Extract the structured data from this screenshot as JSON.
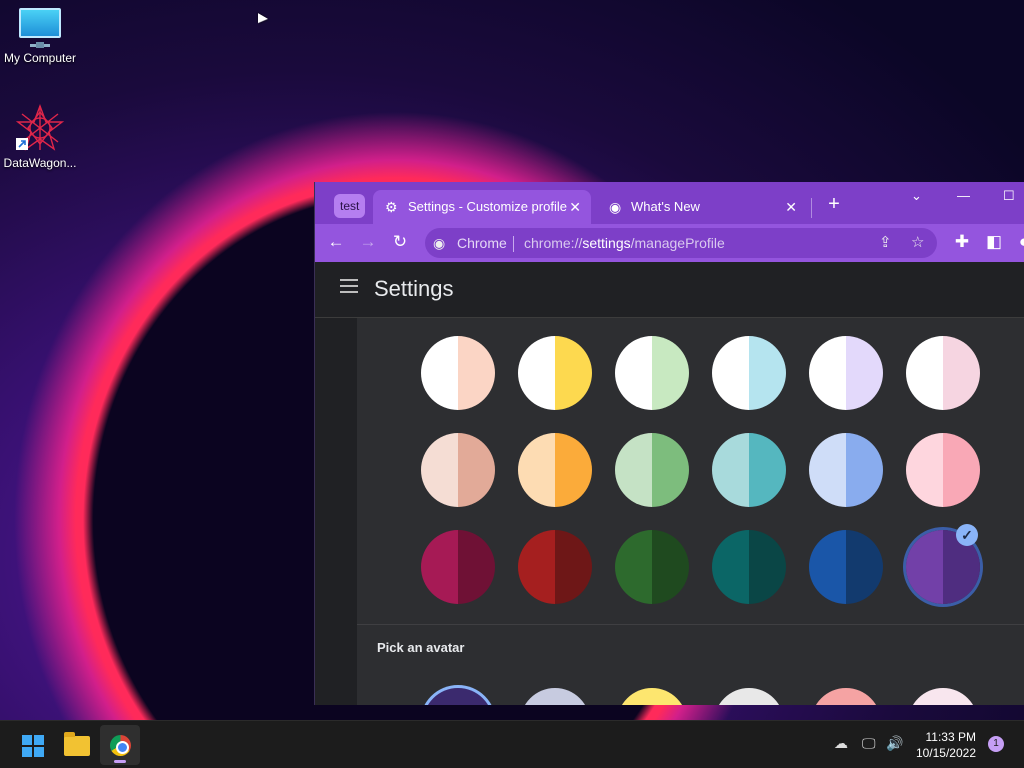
{
  "desktop": {
    "icons": [
      {
        "label": "My Computer",
        "icon": "monitor-icon"
      },
      {
        "label": "DataWagon...",
        "icon": "datawagon-shortcut-icon"
      }
    ]
  },
  "browser": {
    "profile_chip": "test",
    "tabs": [
      {
        "title": "Settings - Customize profile",
        "icon": "gear-icon",
        "active": true
      },
      {
        "title": "What's New",
        "icon": "chrome-icon",
        "active": false
      }
    ],
    "omnibox": {
      "site_name": "Chrome",
      "url_prefix": "chrome://",
      "url_host": "settings",
      "url_path": "/manageProfile"
    },
    "colors": {
      "tabstrip": "#7d3fc8",
      "toolbar": "#9455de"
    }
  },
  "settings": {
    "title": "Settings",
    "swatches": [
      {
        "left": "#ffffff",
        "right": "#fbd5c5"
      },
      {
        "left": "#ffffff",
        "right": "#fdd94f"
      },
      {
        "left": "#ffffff",
        "right": "#c8e9c1"
      },
      {
        "left": "#ffffff",
        "right": "#b5e4ef"
      },
      {
        "left": "#ffffff",
        "right": "#e3d9fb"
      },
      {
        "left": "#ffffff",
        "right": "#f6d5e1"
      },
      {
        "left": "#f5ddd4",
        "right": "#e2aa98"
      },
      {
        "left": "#fddcb3",
        "right": "#fbab3a"
      },
      {
        "left": "#c5e2c5",
        "right": "#7dbd7d"
      },
      {
        "left": "#a8dadc",
        "right": "#55b7bf"
      },
      {
        "left": "#cfddf8",
        "right": "#89acee"
      },
      {
        "left": "#fed6de",
        "right": "#f9a8b6"
      },
      {
        "left": "#a61a55",
        "right": "#6f1135"
      },
      {
        "left": "#a51f1f",
        "right": "#6e1717"
      },
      {
        "left": "#2d6a2d",
        "right": "#1f4a1f"
      },
      {
        "left": "#0b6666",
        "right": "#0a4646"
      },
      {
        "left": "#1a56a8",
        "right": "#123a6e"
      },
      {
        "left": "#7240a8",
        "right": "#4f2d80"
      }
    ],
    "selected_swatch": 17,
    "avatar_heading": "Pick an avatar",
    "avatars": [
      "#3b2a6e",
      "#c7cbe0",
      "#fde66f",
      "#e8e8e8",
      "#f5a3a3",
      "#f8e6ee"
    ]
  },
  "taskbar": {
    "time": "11:33 PM",
    "date": "10/15/2022",
    "notification_count": "1"
  }
}
